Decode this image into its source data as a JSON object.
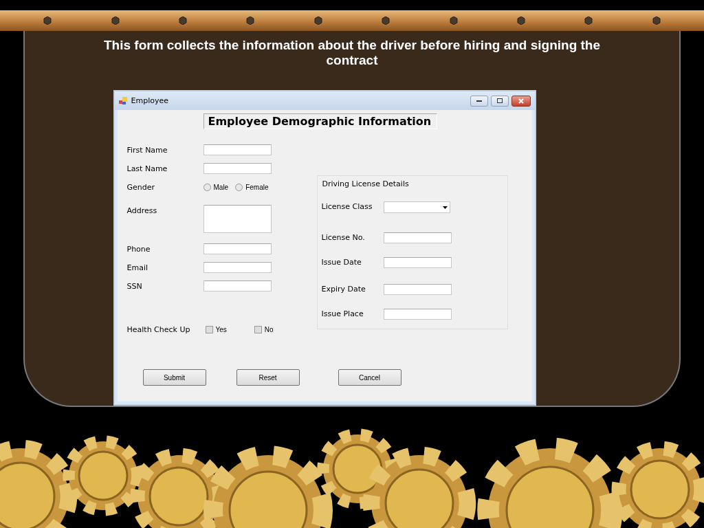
{
  "slide": {
    "caption": "This form collects the information about the driver before hiring and signing the contract"
  },
  "window": {
    "title": "Employee",
    "heading": "Employee Demographic Information"
  },
  "fields": [
    {
      "kind": "text",
      "label": "First Name"
    },
    {
      "kind": "text",
      "label": "Last Name"
    },
    {
      "kind": "radio",
      "label": "Gender",
      "options": [
        {
          "label": "Male",
          "selected": false
        },
        {
          "label": "Female",
          "selected": false
        }
      ]
    },
    {
      "kind": "textarea",
      "label": "Address"
    },
    {
      "kind": "text",
      "label": "Phone"
    },
    {
      "kind": "text",
      "label": "Email"
    },
    {
      "kind": "text",
      "label": "SSN"
    },
    {
      "kind": "checkbox",
      "label": "Health Check Up",
      "options": [
        {
          "label": "Yes",
          "checked": false
        },
        {
          "label": "No",
          "checked": false
        }
      ]
    }
  ],
  "license": {
    "title": "Driving License Details",
    "fields": [
      {
        "kind": "dropdown",
        "label": "License Class"
      },
      {
        "kind": "text",
        "label": "License No."
      },
      {
        "kind": "text",
        "label": "Issue Date"
      },
      {
        "kind": "text",
        "label": "Expiry Date"
      },
      {
        "kind": "text",
        "label": "Issue Place"
      }
    ]
  },
  "buttons": [
    "Submit",
    "Reset",
    "Cancel"
  ]
}
